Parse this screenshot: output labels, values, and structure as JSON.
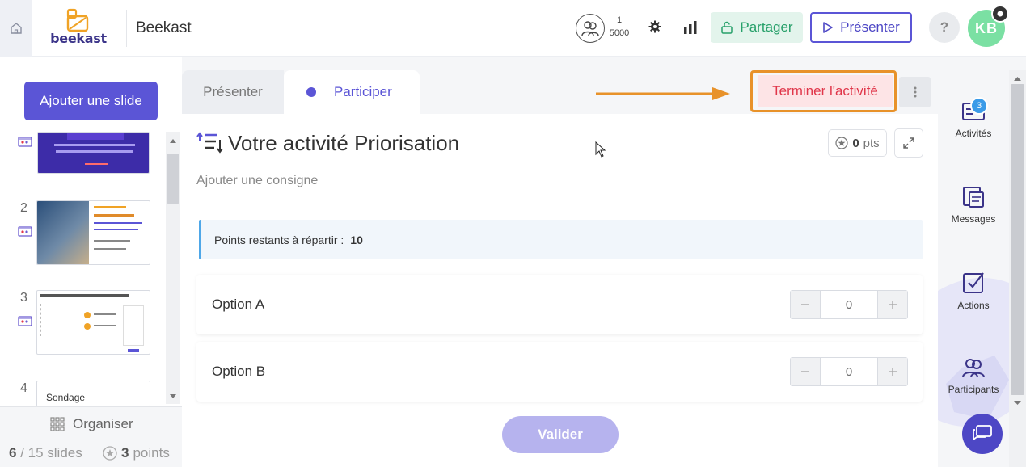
{
  "header": {
    "app_title": "Beekast",
    "logo_text": "beekast",
    "participants_current": "1",
    "participants_max": "5000",
    "share_label": "Partager",
    "present_label": "Présenter",
    "help_label": "?",
    "avatar_initials": "KB"
  },
  "left_panel": {
    "add_slide_label": "Ajouter une slide",
    "slides": [
      {
        "number": "",
        "kind": "presentation"
      },
      {
        "number": "2",
        "kind": "presentation"
      },
      {
        "number": "3",
        "kind": "presentation"
      },
      {
        "number": "4",
        "kind": "poll",
        "thumb_text": "Sondage"
      }
    ],
    "organise_label": "Organiser",
    "slide_index": "6",
    "slide_total_text": "/ 15 slides",
    "points_value": "3",
    "points_unit": "points"
  },
  "main": {
    "tabs": [
      {
        "label": "Présenter",
        "active": false
      },
      {
        "label": "Participer",
        "active": true
      }
    ],
    "end_activity_label": "Terminer l'activité",
    "activity_title": "Votre activité Priorisation",
    "points_value": "0",
    "points_unit": "pts",
    "instruction_placeholder": "Ajouter une consigne",
    "remaining_label": "Points restants à répartir :",
    "remaining_value": "10",
    "options": [
      {
        "label": "Option A",
        "value": "0"
      },
      {
        "label": "Option B",
        "value": "0"
      }
    ],
    "submit_label": "Valider"
  },
  "right_sidebar": {
    "items": [
      {
        "label": "Activités",
        "badge": "3",
        "icon": "activities-icon"
      },
      {
        "label": "Messages",
        "icon": "messages-icon"
      },
      {
        "label": "Actions",
        "icon": "actions-icon"
      },
      {
        "label": "Participants",
        "icon": "participants-icon",
        "active": true
      }
    ]
  },
  "colors": {
    "brand": "#5b55d6",
    "share_green": "#27a06a",
    "end_red": "#e0364a",
    "annotation_orange": "#e8922a",
    "avatar_green": "#7be0a3"
  }
}
